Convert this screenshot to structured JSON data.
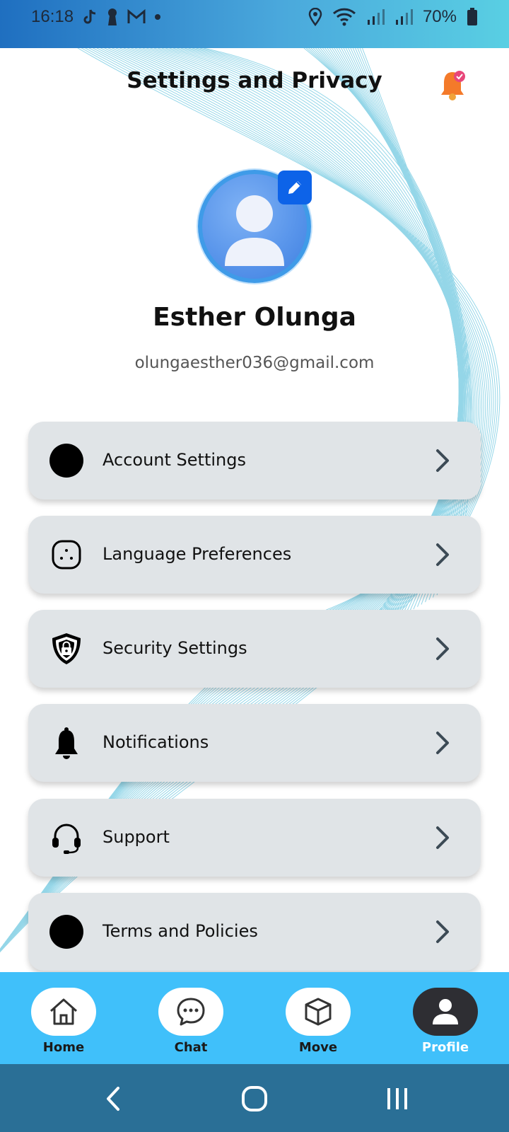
{
  "status_bar": {
    "time": "16:18",
    "battery": "70%",
    "icons": [
      "tiktok-icon",
      "keyhole-icon",
      "gmail-icon",
      "dot-icon",
      "location-icon",
      "wifi-icon",
      "signal-icon",
      "signal-icon",
      "battery-icon"
    ]
  },
  "header": {
    "title": "Settings and Privacy",
    "notification_icon": "bell-with-check-badge-icon"
  },
  "profile": {
    "name": "Esther Olunga",
    "email": "olungaesther036@gmail.com",
    "avatar_icon": "user-placeholder-icon",
    "edit_icon": "pencil-icon"
  },
  "menu": {
    "items": [
      {
        "label": "Account Settings",
        "icon": "black-circle-icon"
      },
      {
        "label": "Language Preferences",
        "icon": "language-face-icon"
      },
      {
        "label": "Security Settings",
        "icon": "shield-lock-icon"
      },
      {
        "label": "Notifications",
        "icon": "bell-icon"
      },
      {
        "label": "Support",
        "icon": "headset-icon"
      },
      {
        "label": "Terms and Policies",
        "icon": "black-circle-icon"
      }
    ]
  },
  "bottom_nav": {
    "items": [
      {
        "label": "Home",
        "icon": "home-icon",
        "active": false
      },
      {
        "label": "Chat",
        "icon": "chat-bubble-icon",
        "active": false
      },
      {
        "label": "Move",
        "icon": "box-icon",
        "active": false
      },
      {
        "label": "Profile",
        "icon": "user-icon",
        "active": true
      }
    ]
  },
  "system_nav": {
    "buttons": [
      "back-icon",
      "home-circle-icon",
      "recents-icon"
    ]
  },
  "colors": {
    "nav_background": "#40c0fa",
    "active_tab": "#2e2e33",
    "card_background": "#e0e4e7",
    "edit_button": "#0d63e8",
    "system_nav": "#2a6f96"
  }
}
